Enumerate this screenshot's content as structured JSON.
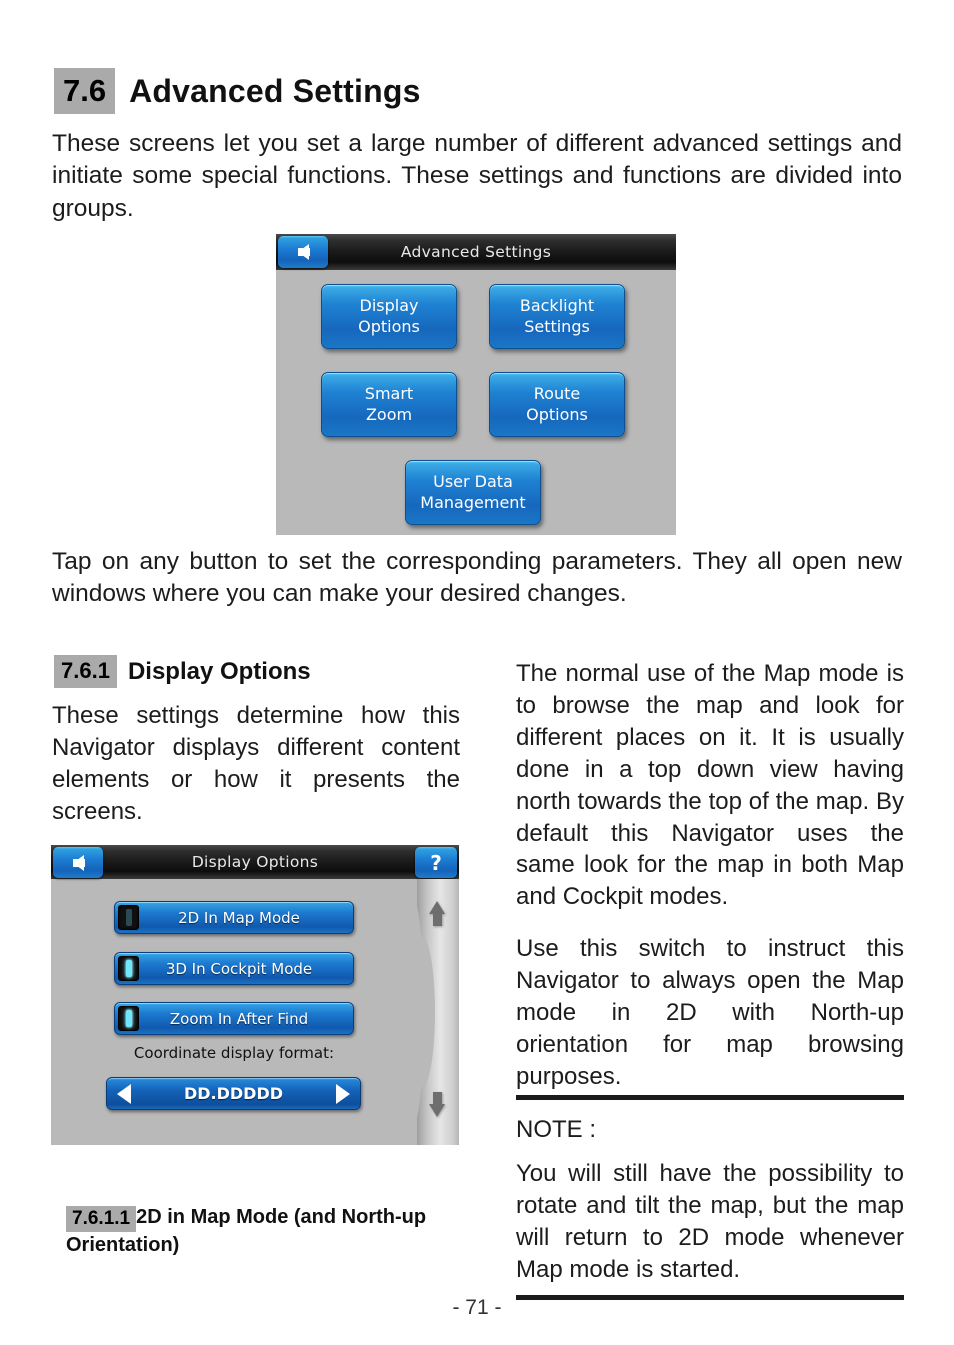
{
  "document": {
    "page_number": "- 71 -"
  },
  "section_7_6": {
    "number": "7.6",
    "title": "Advanced Settings",
    "intro": "These screens let you set a large number of different advanced settings and initiate some special functions. These settings and functions are divided into groups.",
    "after_figure": "Tap on any button to set the corresponding parameters. They all open new windows where you can make your desired changes."
  },
  "figure_advanced_settings": {
    "titlebar": "Advanced Settings",
    "back_icon": "back-arrow-icon",
    "buttons": [
      {
        "label": "Display\nOptions",
        "line1": "Display",
        "line2": "Options"
      },
      {
        "label": "Backlight\nSettings",
        "line1": "Backlight",
        "line2": "Settings"
      },
      {
        "label": "Smart\nZoom",
        "line1": "Smart",
        "line2": "Zoom"
      },
      {
        "label": "Route\nOptions",
        "line1": "Route",
        "line2": "Options"
      },
      {
        "label": "User Data\nManagement",
        "line1": "User Data",
        "line2": "Management"
      }
    ]
  },
  "section_7_6_1": {
    "number": "7.6.1",
    "title": "Display Options",
    "body": "These settings determine how this Navigator displays different content elements or how it presents the screens."
  },
  "figure_display_options": {
    "titlebar": "Display Options",
    "back_icon": "back-arrow-icon",
    "help_label": "?",
    "toggles": [
      {
        "label": "2D In Map Mode",
        "state": "off"
      },
      {
        "label": "3D In Cockpit Mode",
        "state": "on"
      },
      {
        "label": "Zoom In After Find",
        "state": "on"
      }
    ],
    "coordinate_label": "Coordinate display format:",
    "coordinate_value": "DD.DDDDD",
    "prev_icon": "triangle-left-icon",
    "next_icon": "triangle-right-icon",
    "scroll_up_icon": "arrow-up-icon",
    "scroll_down_icon": "arrow-down-icon"
  },
  "right_column": {
    "paragraph_1": "The normal use of the Map mode is to browse the map and look for different places on it. It is usually done in a top down view having north towards the top of the map. By default this Navigator uses the same look for the map in both Map and Cockpit modes.",
    "paragraph_2": "Use this switch to instruct this Navigator to always open the Map mode in 2D with North-up orientation for map browsing purposes."
  },
  "note": {
    "label": "NOTE :",
    "body": "You will still have the possibility to rotate and tilt the map, but the map will return to 2D mode whenever Map mode is started."
  },
  "section_7_6_1_1": {
    "number": "7.6.1.1",
    "title": "2D in Map Mode (and North-up Orientation)"
  },
  "colors": {
    "heading_highlight": "#aaaaaa",
    "device_background": "#b9b9b9",
    "button_blue": "#1f7cc9",
    "titlebar_dark": "#1a1a1a",
    "toggle_on": "#6fe8ff"
  }
}
